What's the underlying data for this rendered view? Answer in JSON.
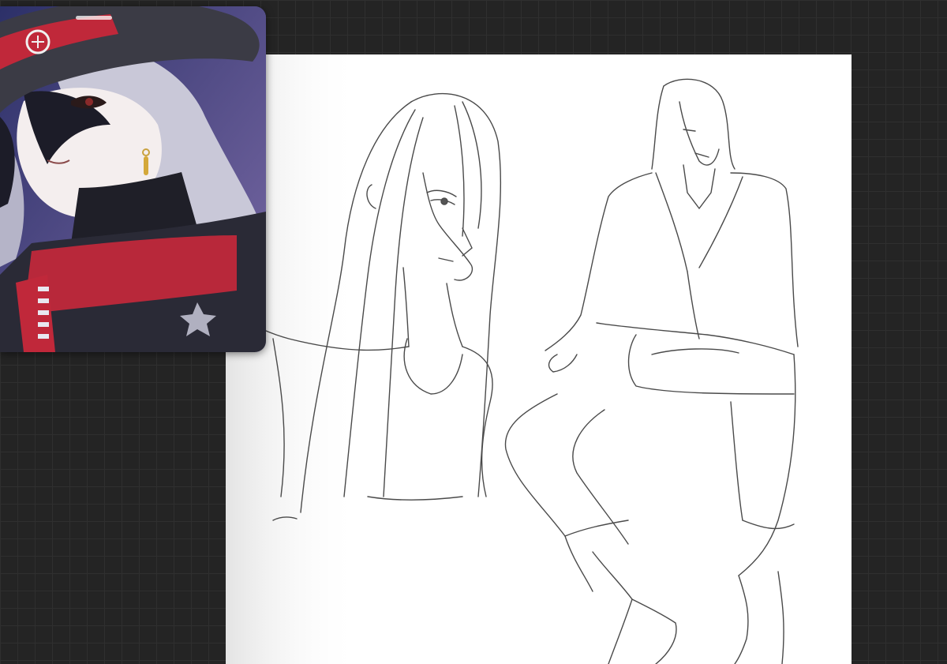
{
  "app": {
    "canvas_background": "#ffffff",
    "workspace_background": "#242424",
    "grid_color": "#2f2f2f"
  },
  "reference_window": {
    "content": "reference-image",
    "colors": {
      "background": "#3a3d74",
      "hat": "#3b3b45",
      "hat_band": "#c0283a",
      "hair": "#c9c8d8",
      "skin": "#f4eeee",
      "coat": "#b8283a",
      "collar": "#1f1f28"
    }
  },
  "sketch": {
    "stroke_color": "#555555",
    "figures": [
      "portrait-bust-sketch",
      "seated-figure-sketch"
    ]
  }
}
